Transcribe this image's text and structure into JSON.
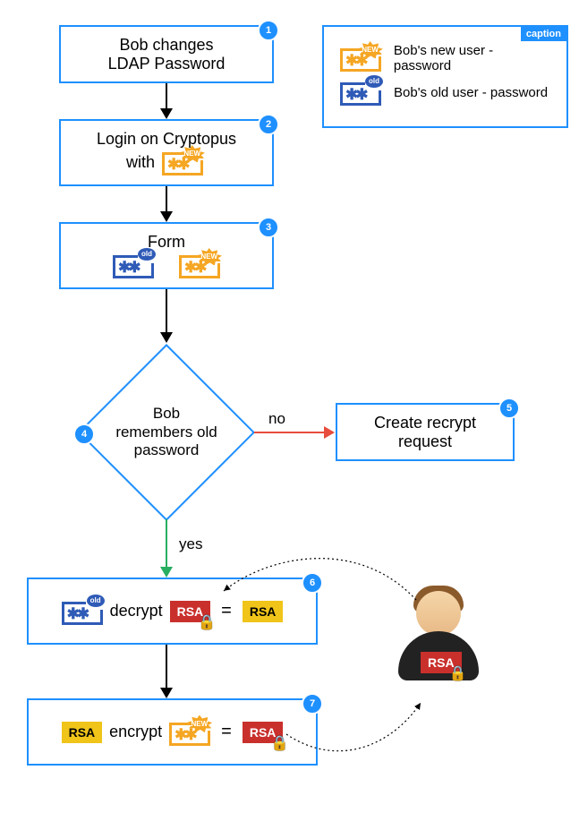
{
  "nodes": {
    "n1": {
      "num": "1",
      "text": "Bob changes\nLDAP Password"
    },
    "n2": {
      "num": "2",
      "text": "Login on Cryptopus with"
    },
    "n3": {
      "num": "3",
      "text": "Form"
    },
    "n4": {
      "num": "4",
      "text": "Bob remembers old password"
    },
    "n5": {
      "num": "5",
      "text": "Create recrypt request"
    },
    "n6": {
      "num": "6",
      "text_left": "decrypt",
      "chip1": "RSA",
      "chip2": "RSA"
    },
    "n7": {
      "num": "7",
      "chip1": "RSA",
      "text_mid": "encrypt",
      "chip2": "RSA"
    }
  },
  "edges": {
    "no": "no",
    "yes": "yes"
  },
  "caption": {
    "tag": "caption",
    "row1": "Bob's new user - password",
    "row2": "Bob's old user - password"
  },
  "icons": {
    "new_badge": "NEW",
    "old_badge": "old",
    "asterisk": "✱✱"
  },
  "person_chip": "RSA",
  "equals": "="
}
